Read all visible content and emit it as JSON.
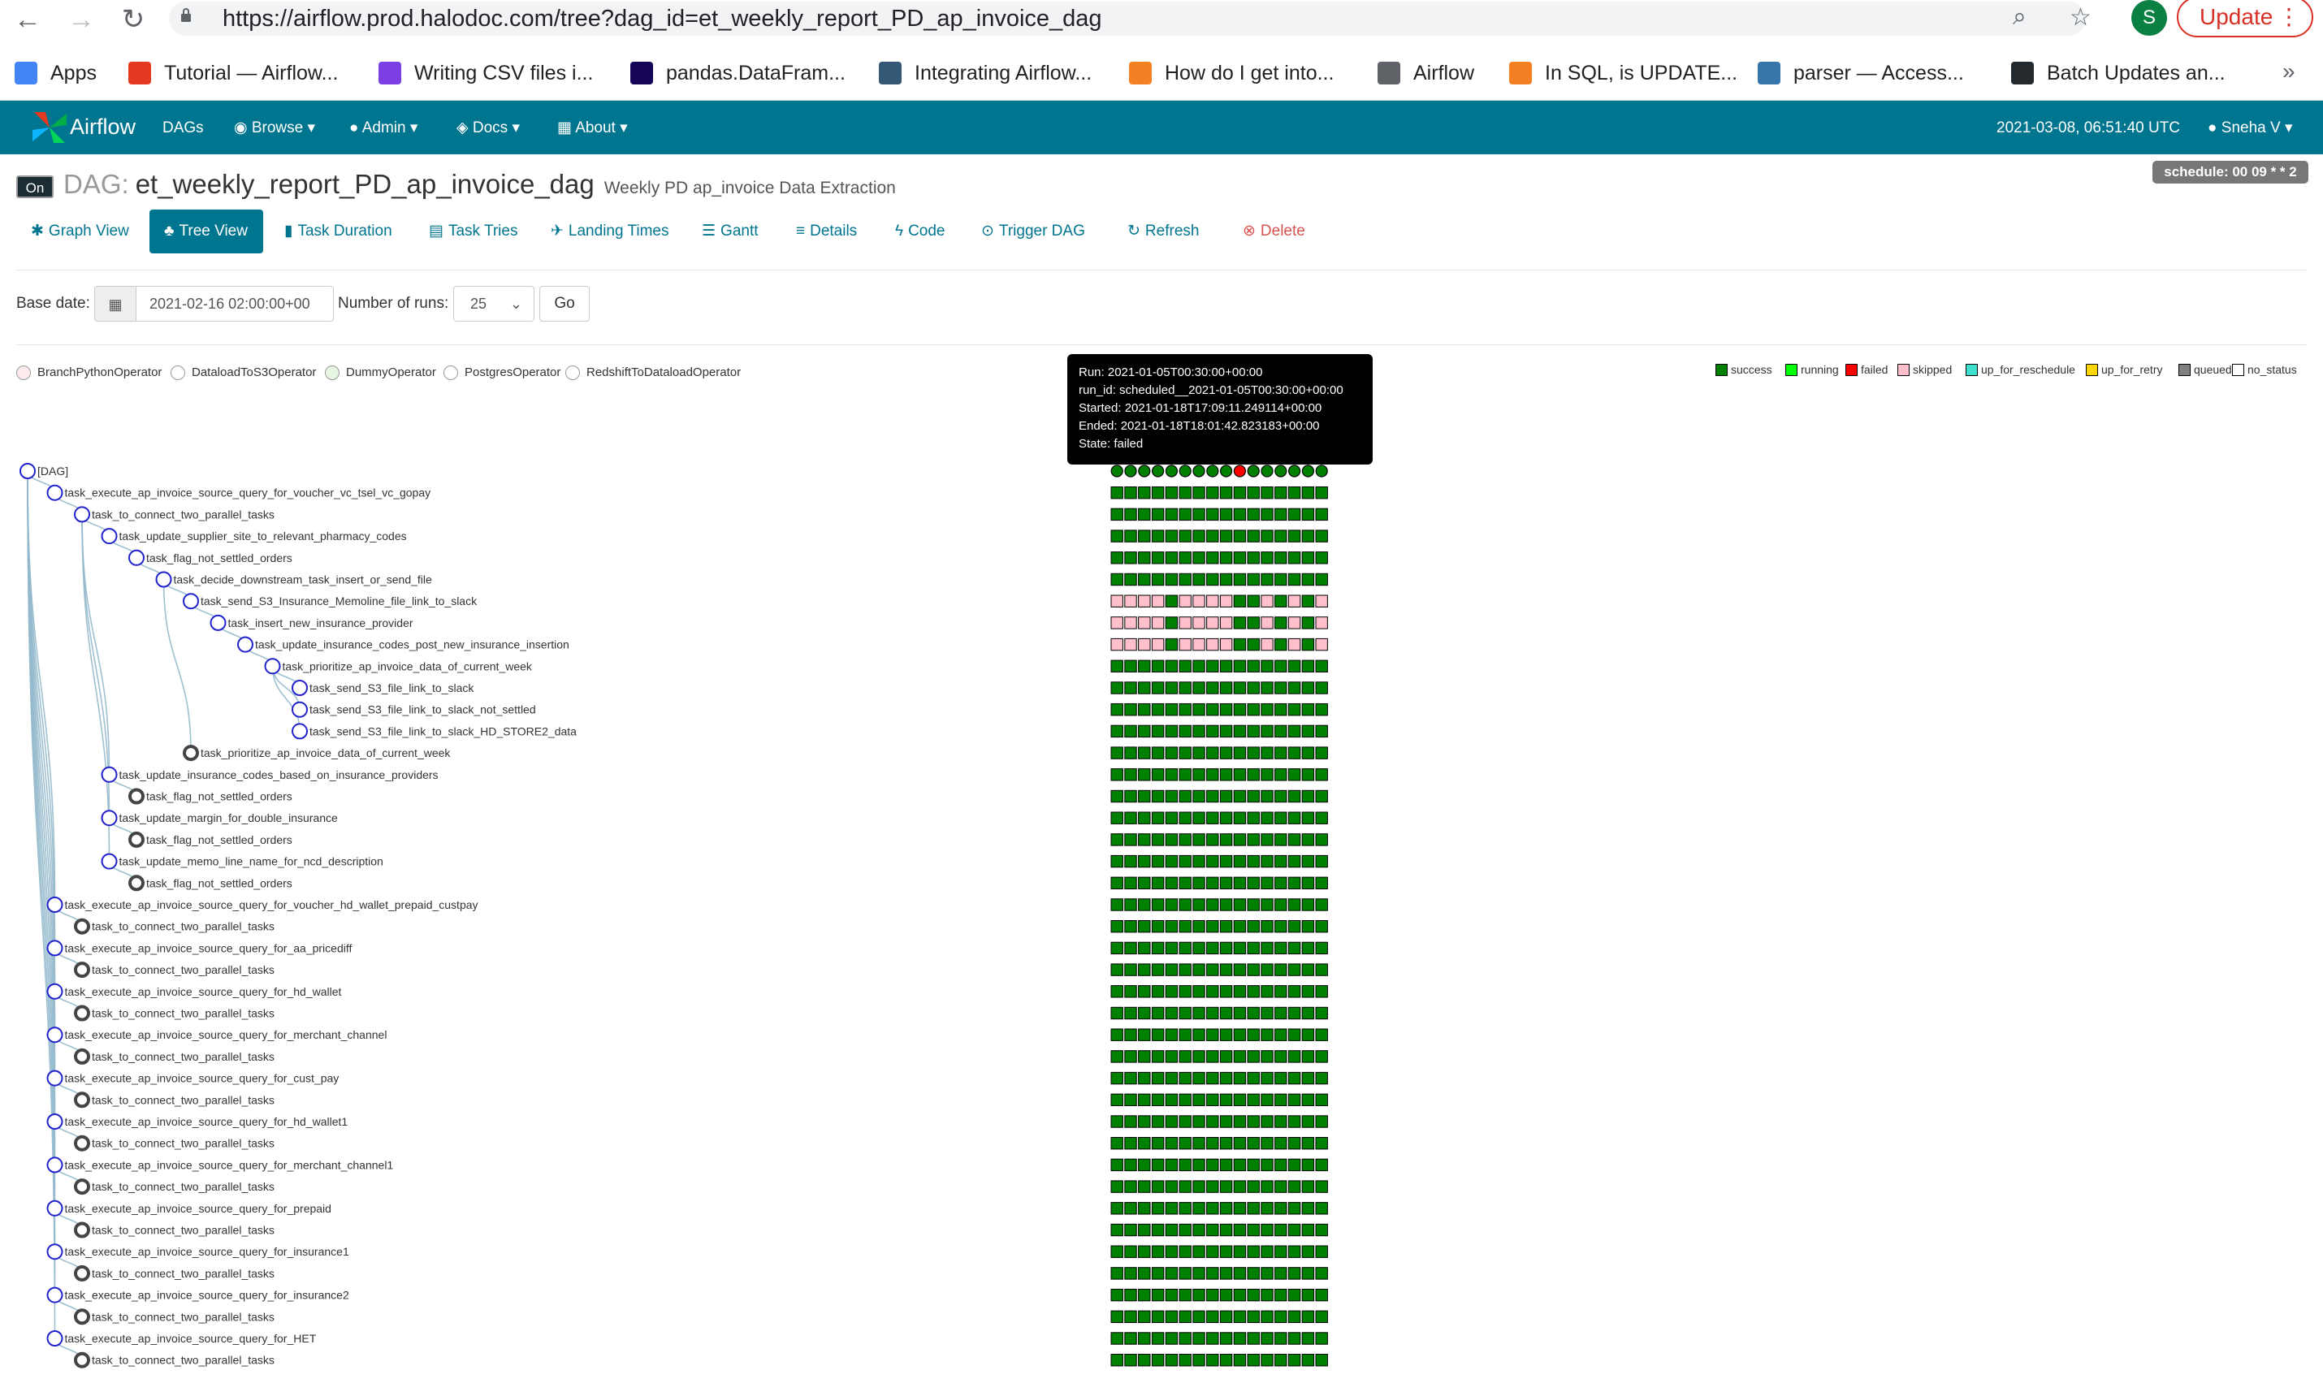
{
  "browser": {
    "url": "https://airflow.prod.halodoc.com/tree?dag_id=et_weekly_report_PD_ap_invoice_dag",
    "profile_initial": "S",
    "update_label": "Update",
    "bookmarks": [
      {
        "label": "Apps",
        "icon": "apps-grid-icon",
        "color": "#4285f4"
      },
      {
        "label": "Tutorial — Airflow...",
        "icon": "airflow-pinwheel-icon",
        "color": "#e43921"
      },
      {
        "label": "Writing CSV files i...",
        "icon": "p-logo-icon",
        "color": "#7b3fe4"
      },
      {
        "label": "pandas.DataFram...",
        "icon": "pandas-icon",
        "color": "#150458"
      },
      {
        "label": "Integrating Airflow...",
        "icon": "tds-icon",
        "color": "#355876"
      },
      {
        "label": "How do I get into...",
        "icon": "stackoverflow-icon",
        "color": "#f48024"
      },
      {
        "label": "Airflow",
        "icon": "globe-icon",
        "color": "#5f6368"
      },
      {
        "label": "In SQL, is UPDATE...",
        "icon": "stackoverflow-icon",
        "color": "#f48024"
      },
      {
        "label": "parser — Access...",
        "icon": "python-icon",
        "color": "#3776ab"
      },
      {
        "label": "Batch Updates an...",
        "icon": "github-icon",
        "color": "#24292e"
      }
    ]
  },
  "nav": {
    "brand": "Airflow",
    "menus": [
      "DAGs",
      "Browse",
      "Admin",
      "Docs",
      "About"
    ],
    "time": "2021-03-08, 06:51:40 UTC",
    "user": "Sneha V"
  },
  "dag": {
    "toggle": "On",
    "prefix": "DAG:",
    "id": "et_weekly_report_PD_ap_invoice_dag",
    "description": "Weekly PD ap_invoice Data Extraction",
    "schedule": "schedule: 00 09 * * 2"
  },
  "tabs": [
    "Graph View",
    "Tree View",
    "Task Duration",
    "Task Tries",
    "Landing Times",
    "Gantt",
    "Details",
    "Code",
    "Trigger DAG",
    "Refresh",
    "Delete"
  ],
  "form": {
    "base_label": "Base date:",
    "base_value": "2021-02-16 02:00:00+00",
    "runs_label": "Number of runs:",
    "runs_value": "25",
    "go_label": "Go"
  },
  "operators": [
    {
      "name": "BranchPythonOperator",
      "color": "#ffebee"
    },
    {
      "name": "DataloadToS3Operator",
      "color": "#ffffff"
    },
    {
      "name": "DummyOperator",
      "color": "#e8f7e4"
    },
    {
      "name": "PostgresOperator",
      "color": "#ffffff"
    },
    {
      "name": "RedshiftToDataloadOperator",
      "color": "#ffffff"
    }
  ],
  "states": [
    {
      "name": "success",
      "color": "#008000"
    },
    {
      "name": "running",
      "color": "#00ff00"
    },
    {
      "name": "failed",
      "color": "#ff0000"
    },
    {
      "name": "skipped",
      "color": "#ffc0cb"
    },
    {
      "name": "up_for_reschedule",
      "color": "#40e0d0"
    },
    {
      "name": "up_for_retry",
      "color": "#ffd700"
    },
    {
      "name": "queued",
      "color": "#808080"
    },
    {
      "name": "no_status",
      "color": "#ffffff"
    }
  ],
  "tooltip": {
    "run": "Run: 2021-01-05T00:30:00+00:00",
    "run_id": "run_id: scheduled__2021-01-05T00:30:00+00:00",
    "started": "Started: 2021-01-18T17:09:11.249114+00:00",
    "ended": "Ended: 2021-01-18T18:01:42.823183+00:00",
    "state": "State: failed"
  },
  "tree": {
    "runs": 16,
    "failed_run_index": 9,
    "nodes": [
      {
        "label": "[DAG]",
        "depth": 0,
        "leaf": false
      },
      {
        "label": "task_execute_ap_invoice_source_query_for_voucher_vc_tsel_vc_gopay",
        "depth": 1,
        "leaf": false
      },
      {
        "label": "task_to_connect_two_parallel_tasks",
        "depth": 2,
        "leaf": false
      },
      {
        "label": "task_update_supplier_site_to_relevant_pharmacy_codes",
        "depth": 3,
        "leaf": false
      },
      {
        "label": "task_flag_not_settled_orders",
        "depth": 4,
        "leaf": false
      },
      {
        "label": "task_decide_downstream_task_insert_or_send_file",
        "depth": 5,
        "leaf": false
      },
      {
        "label": "task_send_S3_Insurance_Memoline_file_link_to_slack",
        "depth": 6,
        "leaf": false,
        "pattern": "skip"
      },
      {
        "label": "task_insert_new_insurance_provider",
        "depth": 7,
        "leaf": false,
        "pattern": "skip"
      },
      {
        "label": "task_update_insurance_codes_post_new_insurance_insertion",
        "depth": 8,
        "leaf": false,
        "pattern": "skip"
      },
      {
        "label": "task_prioritize_ap_invoice_data_of_current_week",
        "depth": 9,
        "leaf": false
      },
      {
        "label": "task_send_S3_file_link_to_slack",
        "depth": 10,
        "leaf": false
      },
      {
        "label": "task_send_S3_file_link_to_slack_not_settled",
        "depth": 10,
        "leaf": false
      },
      {
        "label": "task_send_S3_file_link_to_slack_HD_STORE2_data",
        "depth": 10,
        "leaf": false
      },
      {
        "label": "task_prioritize_ap_invoice_data_of_current_week",
        "depth": 6,
        "leaf": true
      },
      {
        "label": "task_update_insurance_codes_based_on_insurance_providers",
        "depth": 3,
        "leaf": false
      },
      {
        "label": "task_flag_not_settled_orders",
        "depth": 4,
        "leaf": true
      },
      {
        "label": "task_update_margin_for_double_insurance",
        "depth": 3,
        "leaf": false
      },
      {
        "label": "task_flag_not_settled_orders",
        "depth": 4,
        "leaf": true
      },
      {
        "label": "task_update_memo_line_name_for_ncd_description",
        "depth": 3,
        "leaf": false
      },
      {
        "label": "task_flag_not_settled_orders",
        "depth": 4,
        "leaf": true
      },
      {
        "label": "task_execute_ap_invoice_source_query_for_voucher_hd_wallet_prepaid_custpay",
        "depth": 1,
        "leaf": false
      },
      {
        "label": "task_to_connect_two_parallel_tasks",
        "depth": 2,
        "leaf": true
      },
      {
        "label": "task_execute_ap_invoice_source_query_for_aa_pricediff",
        "depth": 1,
        "leaf": false
      },
      {
        "label": "task_to_connect_two_parallel_tasks",
        "depth": 2,
        "leaf": true
      },
      {
        "label": "task_execute_ap_invoice_source_query_for_hd_wallet",
        "depth": 1,
        "leaf": false
      },
      {
        "label": "task_to_connect_two_parallel_tasks",
        "depth": 2,
        "leaf": true
      },
      {
        "label": "task_execute_ap_invoice_source_query_for_merchant_channel",
        "depth": 1,
        "leaf": false
      },
      {
        "label": "task_to_connect_two_parallel_tasks",
        "depth": 2,
        "leaf": true
      },
      {
        "label": "task_execute_ap_invoice_source_query_for_cust_pay",
        "depth": 1,
        "leaf": false
      },
      {
        "label": "task_to_connect_two_parallel_tasks",
        "depth": 2,
        "leaf": true
      },
      {
        "label": "task_execute_ap_invoice_source_query_for_hd_wallet1",
        "depth": 1,
        "leaf": false
      },
      {
        "label": "task_to_connect_two_parallel_tasks",
        "depth": 2,
        "leaf": true
      },
      {
        "label": "task_execute_ap_invoice_source_query_for_merchant_channel1",
        "depth": 1,
        "leaf": false
      },
      {
        "label": "task_to_connect_two_parallel_tasks",
        "depth": 2,
        "leaf": true
      },
      {
        "label": "task_execute_ap_invoice_source_query_for_prepaid",
        "depth": 1,
        "leaf": false
      },
      {
        "label": "task_to_connect_two_parallel_tasks",
        "depth": 2,
        "leaf": true
      },
      {
        "label": "task_execute_ap_invoice_source_query_for_insurance1",
        "depth": 1,
        "leaf": false
      },
      {
        "label": "task_to_connect_two_parallel_tasks",
        "depth": 2,
        "leaf": true
      },
      {
        "label": "task_execute_ap_invoice_source_query_for_insurance2",
        "depth": 1,
        "leaf": false
      },
      {
        "label": "task_to_connect_two_parallel_tasks",
        "depth": 2,
        "leaf": true
      },
      {
        "label": "task_execute_ap_invoice_source_query_for_HET",
        "depth": 1,
        "leaf": false
      },
      {
        "label": "task_to_connect_two_parallel_tasks",
        "depth": 2,
        "leaf": true
      }
    ],
    "skip_pattern": [
      "skipped",
      "skipped",
      "skipped",
      "skipped",
      "success",
      "skipped",
      "skipped",
      "skipped",
      "skipped",
      "success",
      "success",
      "skipped",
      "success",
      "skipped",
      "success",
      "skipped"
    ]
  }
}
